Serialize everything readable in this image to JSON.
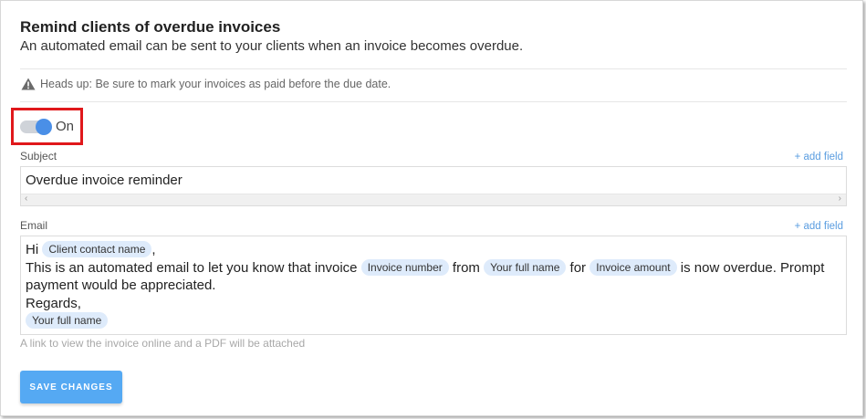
{
  "header": {
    "title": "Remind clients of overdue invoices",
    "description": "An automated email can be sent to your clients when an invoice becomes overdue."
  },
  "notice": {
    "icon": "warning-icon",
    "text": "Heads up: Be sure to mark your invoices as paid before the due date."
  },
  "toggle": {
    "state": "on",
    "label": "On",
    "accent_color": "#4a8fe7"
  },
  "subject": {
    "label": "Subject",
    "add_field_label": "+ add field",
    "value": "Overdue invoice reminder"
  },
  "email": {
    "label": "Email",
    "add_field_label": "+ add field",
    "greeting": "Hi",
    "greeting_suffix": ",",
    "body_intro": "This is an automated email to let you know that invoice",
    "word_from": "from",
    "word_for": "for",
    "body_outro": "is now overdue. Prompt payment would be appreciated.",
    "closing": "Regards,",
    "tokens": {
      "client_contact_name": "Client contact name",
      "invoice_number": "Invoice number",
      "your_full_name": "Your full name",
      "invoice_amount": "Invoice amount",
      "signature_name": "Your full name"
    },
    "hint": "A link to view the invoice online and a PDF will be attached"
  },
  "actions": {
    "save_label": "SAVE CHANGES",
    "save_color": "#55a9f3"
  }
}
